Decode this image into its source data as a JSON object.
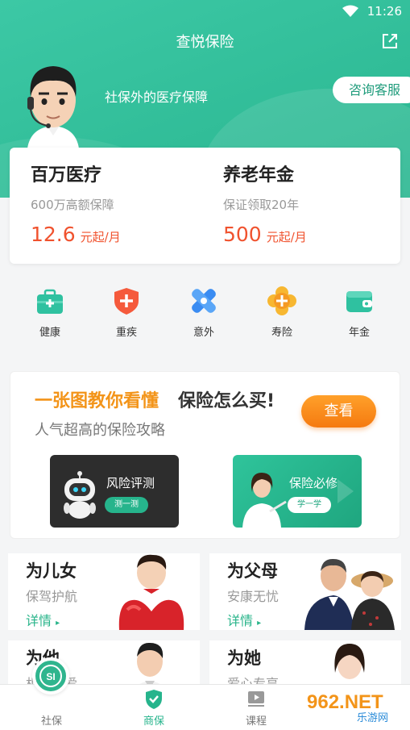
{
  "status": {
    "time": "11:26"
  },
  "header": {
    "title": "查悦保险",
    "slogan": "社保外的医疗保障",
    "consult_label": "咨询客服"
  },
  "products": [
    {
      "name": "百万医疗",
      "desc": "600万高额保障",
      "price": "12.6",
      "unit": "元起/月"
    },
    {
      "name": "养老年金",
      "desc": "保证领取20年",
      "price": "500",
      "unit": "元起/月"
    }
  ],
  "categories": [
    {
      "label": "健康",
      "icon": "medical-kit-icon",
      "color": "#2fc1a0"
    },
    {
      "label": "重疾",
      "icon": "shield-plus-icon",
      "color": "#f55a3c"
    },
    {
      "label": "意外",
      "icon": "bandage-cross-icon",
      "color": "#3a8cf2"
    },
    {
      "label": "寿险",
      "icon": "flower-plus-icon",
      "color": "#f5a623"
    },
    {
      "label": "年金",
      "icon": "wallet-icon",
      "color": "#2fc1a0"
    }
  ],
  "guide": {
    "title_highlight": "一张图教你看懂",
    "title_rest": "保险怎么买!",
    "subtitle": "人气超高的保险攻略",
    "view_label": "查看",
    "risk_title": "风险评测",
    "risk_button": "测一测",
    "must_title": "保险必修",
    "must_button": "学一学"
  },
  "tiles": [
    {
      "title": "为儿女",
      "sub": "保驾护航",
      "link": "详情"
    },
    {
      "title": "为父母",
      "sub": "安康无忧",
      "link": "详情"
    },
    {
      "title": "为他",
      "sub": "相伴相爱",
      "link": ""
    },
    {
      "title": "为她",
      "sub": "爱心专享",
      "link": ""
    }
  ],
  "tabs": [
    {
      "label": "社保",
      "badge": "SI"
    },
    {
      "label": "商保"
    },
    {
      "label": "课程"
    }
  ],
  "watermark": {
    "text": "962.NET",
    "sub": "乐游网"
  },
  "colors": {
    "brand": "#2ab690",
    "accent": "#f39419",
    "price": "#f0522e"
  }
}
